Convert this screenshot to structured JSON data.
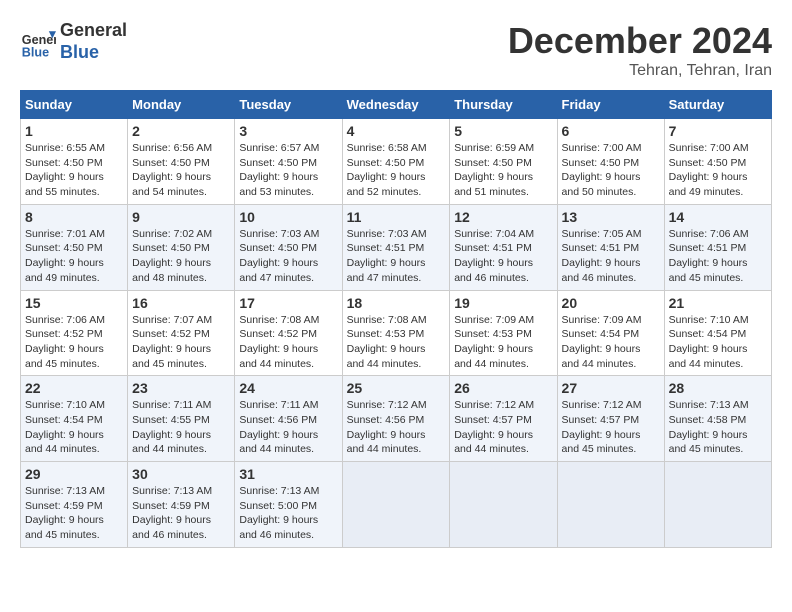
{
  "header": {
    "logo_line1": "General",
    "logo_line2": "Blue",
    "month": "December 2024",
    "location": "Tehran, Tehran, Iran"
  },
  "weekdays": [
    "Sunday",
    "Monday",
    "Tuesday",
    "Wednesday",
    "Thursday",
    "Friday",
    "Saturday"
  ],
  "weeks": [
    [
      {
        "day": "1",
        "sunrise": "6:55 AM",
        "sunset": "4:50 PM",
        "daylight": "9 hours and 55 minutes."
      },
      {
        "day": "2",
        "sunrise": "6:56 AM",
        "sunset": "4:50 PM",
        "daylight": "9 hours and 54 minutes."
      },
      {
        "day": "3",
        "sunrise": "6:57 AM",
        "sunset": "4:50 PM",
        "daylight": "9 hours and 53 minutes."
      },
      {
        "day": "4",
        "sunrise": "6:58 AM",
        "sunset": "4:50 PM",
        "daylight": "9 hours and 52 minutes."
      },
      {
        "day": "5",
        "sunrise": "6:59 AM",
        "sunset": "4:50 PM",
        "daylight": "9 hours and 51 minutes."
      },
      {
        "day": "6",
        "sunrise": "7:00 AM",
        "sunset": "4:50 PM",
        "daylight": "9 hours and 50 minutes."
      },
      {
        "day": "7",
        "sunrise": "7:00 AM",
        "sunset": "4:50 PM",
        "daylight": "9 hours and 49 minutes."
      }
    ],
    [
      {
        "day": "8",
        "sunrise": "7:01 AM",
        "sunset": "4:50 PM",
        "daylight": "9 hours and 49 minutes."
      },
      {
        "day": "9",
        "sunrise": "7:02 AM",
        "sunset": "4:50 PM",
        "daylight": "9 hours and 48 minutes."
      },
      {
        "day": "10",
        "sunrise": "7:03 AM",
        "sunset": "4:50 PM",
        "daylight": "9 hours and 47 minutes."
      },
      {
        "day": "11",
        "sunrise": "7:03 AM",
        "sunset": "4:51 PM",
        "daylight": "9 hours and 47 minutes."
      },
      {
        "day": "12",
        "sunrise": "7:04 AM",
        "sunset": "4:51 PM",
        "daylight": "9 hours and 46 minutes."
      },
      {
        "day": "13",
        "sunrise": "7:05 AM",
        "sunset": "4:51 PM",
        "daylight": "9 hours and 46 minutes."
      },
      {
        "day": "14",
        "sunrise": "7:06 AM",
        "sunset": "4:51 PM",
        "daylight": "9 hours and 45 minutes."
      }
    ],
    [
      {
        "day": "15",
        "sunrise": "7:06 AM",
        "sunset": "4:52 PM",
        "daylight": "9 hours and 45 minutes."
      },
      {
        "day": "16",
        "sunrise": "7:07 AM",
        "sunset": "4:52 PM",
        "daylight": "9 hours and 45 minutes."
      },
      {
        "day": "17",
        "sunrise": "7:08 AM",
        "sunset": "4:52 PM",
        "daylight": "9 hours and 44 minutes."
      },
      {
        "day": "18",
        "sunrise": "7:08 AM",
        "sunset": "4:53 PM",
        "daylight": "9 hours and 44 minutes."
      },
      {
        "day": "19",
        "sunrise": "7:09 AM",
        "sunset": "4:53 PM",
        "daylight": "9 hours and 44 minutes."
      },
      {
        "day": "20",
        "sunrise": "7:09 AM",
        "sunset": "4:54 PM",
        "daylight": "9 hours and 44 minutes."
      },
      {
        "day": "21",
        "sunrise": "7:10 AM",
        "sunset": "4:54 PM",
        "daylight": "9 hours and 44 minutes."
      }
    ],
    [
      {
        "day": "22",
        "sunrise": "7:10 AM",
        "sunset": "4:54 PM",
        "daylight": "9 hours and 44 minutes."
      },
      {
        "day": "23",
        "sunrise": "7:11 AM",
        "sunset": "4:55 PM",
        "daylight": "9 hours and 44 minutes."
      },
      {
        "day": "24",
        "sunrise": "7:11 AM",
        "sunset": "4:56 PM",
        "daylight": "9 hours and 44 minutes."
      },
      {
        "day": "25",
        "sunrise": "7:12 AM",
        "sunset": "4:56 PM",
        "daylight": "9 hours and 44 minutes."
      },
      {
        "day": "26",
        "sunrise": "7:12 AM",
        "sunset": "4:57 PM",
        "daylight": "9 hours and 44 minutes."
      },
      {
        "day": "27",
        "sunrise": "7:12 AM",
        "sunset": "4:57 PM",
        "daylight": "9 hours and 45 minutes."
      },
      {
        "day": "28",
        "sunrise": "7:13 AM",
        "sunset": "4:58 PM",
        "daylight": "9 hours and 45 minutes."
      }
    ],
    [
      {
        "day": "29",
        "sunrise": "7:13 AM",
        "sunset": "4:59 PM",
        "daylight": "9 hours and 45 minutes."
      },
      {
        "day": "30",
        "sunrise": "7:13 AM",
        "sunset": "4:59 PM",
        "daylight": "9 hours and 46 minutes."
      },
      {
        "day": "31",
        "sunrise": "7:13 AM",
        "sunset": "5:00 PM",
        "daylight": "9 hours and 46 minutes."
      },
      null,
      null,
      null,
      null
    ]
  ],
  "labels": {
    "sunrise_prefix": "Sunrise: ",
    "sunset_prefix": "Sunset: ",
    "daylight_prefix": "Daylight: "
  }
}
